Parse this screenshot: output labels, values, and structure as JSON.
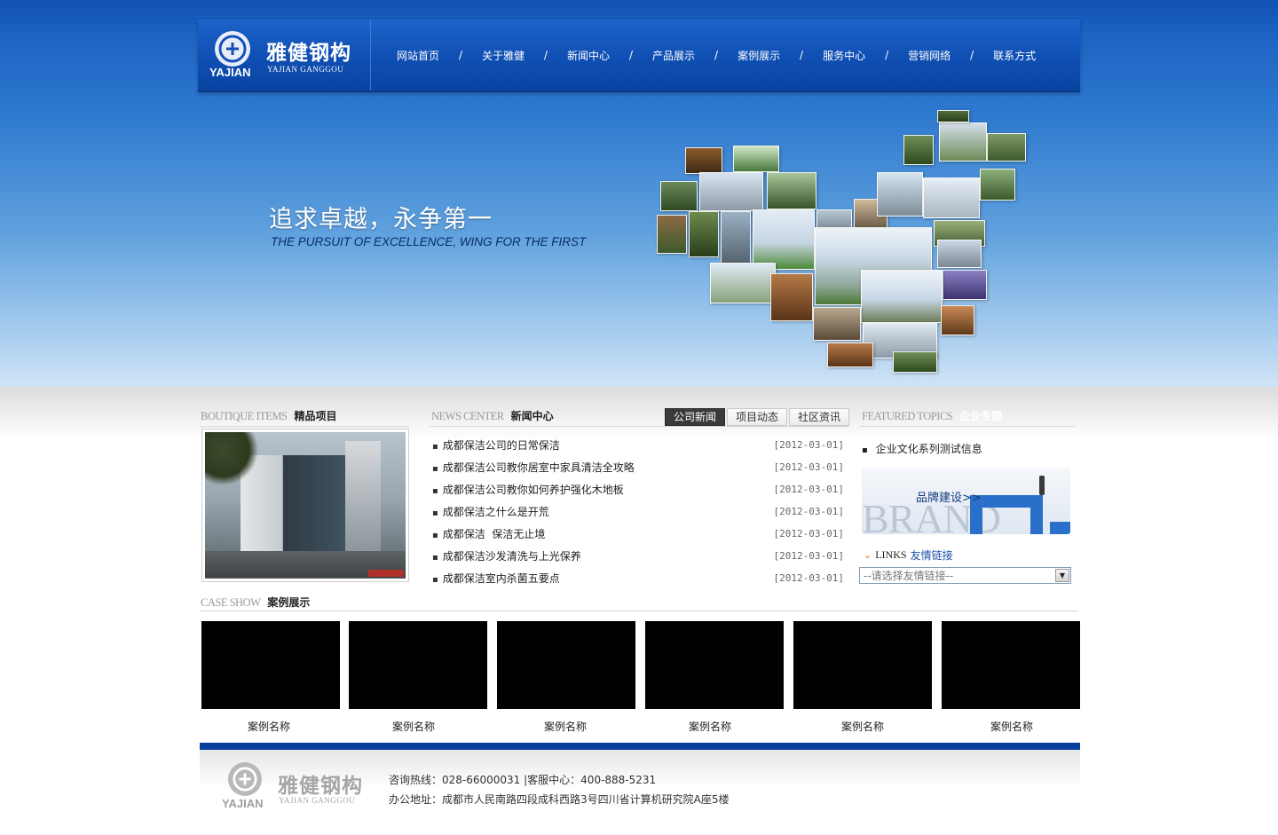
{
  "header": {
    "logo_letters": "YAJIAN",
    "logo_cn": "雅健钢构",
    "logo_en": "YAJIAN GANGGOU",
    "nav": [
      "网站首页",
      "关于雅健",
      "新闻中心",
      "产品展示",
      "案例展示",
      "服务中心",
      "营销网络",
      "联系方式"
    ],
    "nav_separator": "/"
  },
  "banner": {
    "slogan_cn": "追求卓越，永争第一",
    "slogan_en": "THE PURSUIT OF EXCELLENCE, WING FOR THE FIRST"
  },
  "boutique": {
    "title_en": "BOUTIQUE ITEMS",
    "title_cn": "精品项目"
  },
  "news": {
    "title_en": "NEWS CENTER",
    "title_cn": "新闻中心",
    "tabs": [
      "公司新闻",
      "项目动态",
      "社区资讯"
    ],
    "active_tab": 0,
    "items": [
      {
        "title": "成都保洁公司的日常保洁",
        "date": "[2012-03-01]"
      },
      {
        "title": "成都保洁公司教你居室中家具清洁全攻略",
        "date": "[2012-03-01]"
      },
      {
        "title": "成都保洁公司教你如何养护强化木地板",
        "date": "[2012-03-01]"
      },
      {
        "title": "成都保洁之什么是开荒",
        "date": "[2012-03-01]"
      },
      {
        "title": "成都保洁  保洁无止境",
        "date": "[2012-03-01]"
      },
      {
        "title": "成都保洁沙发清洗与上光保养",
        "date": "[2012-03-01]"
      },
      {
        "title": "成都保洁室内杀菌五要点",
        "date": "[2012-03-01]"
      }
    ]
  },
  "featured": {
    "title_en": "FEATURED TOPICS",
    "title_cn": "企业专题",
    "item": "企业文化系列测试信息",
    "brand_label": "品牌建设>>",
    "brand_word": "BRAND"
  },
  "links": {
    "title_en": "LINKS",
    "title_cn": "友情链接",
    "placeholder": "--请选择友情链接--"
  },
  "cases": {
    "title_en": "CASE SHOW",
    "title_cn": "案例展示",
    "items": [
      "案例名称",
      "案例名称",
      "案例名称",
      "案例名称",
      "案例名称",
      "案例名称"
    ]
  },
  "footer": {
    "logo_letters": "YAJIAN",
    "logo_cn": "雅健钢构",
    "logo_en": "YAJIAN GANGGOU",
    "contact": "咨询热线：028-66000031 |客服中心：400-888-5231",
    "address": "办公地址：成都市人民南路四段成科西路3号四川省计算机研究院A座5楼"
  },
  "colors": {
    "brand_blue": "#0f4fb3",
    "footer_bar": "#0a3f9c",
    "active_tab": "#3a3a3a",
    "case_placeholder": "#000000"
  }
}
